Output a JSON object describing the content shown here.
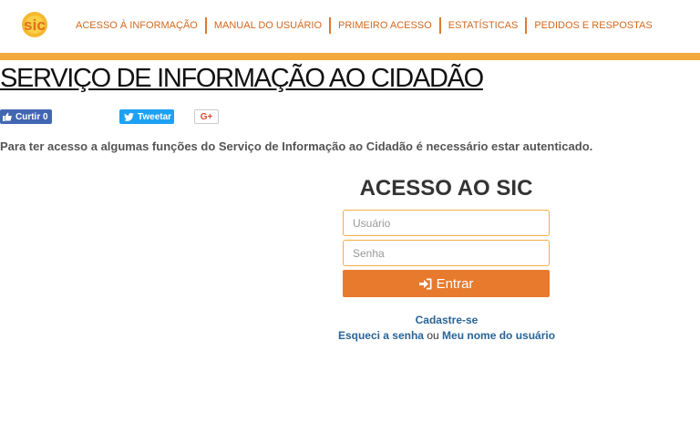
{
  "header": {
    "logo_text": "sic",
    "nav": [
      "ACESSO À INFORMAÇÃO",
      "MANUAL DO USUÁRIO",
      "PRIMEIRO ACESSO",
      "ESTATÍSTICAS",
      "PEDIDOS E RESPOSTAS"
    ]
  },
  "page": {
    "title": "SERVIÇO DE INFORMAÇÃO AO CIDADÃO",
    "auth_message": "Para ter acesso a algumas funções do Serviço de Informação ao Cidadão é necessário estar autenticado."
  },
  "social": {
    "facebook_label": "Curtir 0",
    "twitter_label": "Tweetar",
    "gplus_label": "G+"
  },
  "login": {
    "title": "ACESSO AO SIC",
    "username_placeholder": "Usuário",
    "password_placeholder": "Senha",
    "submit_label": "Entrar",
    "register_link": "Cadastre-se",
    "forgot_password_link": "Esqueci a senha",
    "separator": "ou",
    "forgot_username_link": "Meu nome do usuário"
  },
  "colors": {
    "accent_orange": "#e87a2e",
    "bar_orange": "#f2a83a",
    "link_blue": "#2a6496"
  }
}
